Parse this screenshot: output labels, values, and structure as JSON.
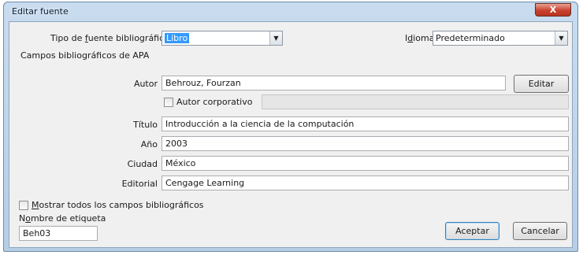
{
  "window": {
    "title": "Editar fuente",
    "close_glyph": "X"
  },
  "source_type": {
    "label_pre": "Tipo de ",
    "label_ul": "f",
    "label_post": "uente bibliográfica",
    "value": "Libro"
  },
  "language": {
    "label_pre": "I",
    "label_ul": "d",
    "label_post": "ioma",
    "value": "Predeterminado"
  },
  "section_title": "Campos bibliográficos de APA",
  "fields": {
    "author": {
      "label": "Autor",
      "value": "Behrouz, Fourzan"
    },
    "corporate_author": {
      "label": "Autor corporativo",
      "value": ""
    },
    "title": {
      "label": "Título",
      "value": "Introducción a la ciencia de la computación"
    },
    "year": {
      "label": "Año",
      "value": "2003"
    },
    "city": {
      "label": "Ciudad",
      "value": "México"
    },
    "publisher": {
      "label": "Editorial",
      "value": "Cengage Learning"
    }
  },
  "edit_button": "Editar",
  "show_all": {
    "label_ul": "M",
    "label_post": "ostrar todos los campos bibliográficos",
    "checked": false
  },
  "tag_name": {
    "label_pre": "N",
    "label_ul": "o",
    "label_post": "mbre de etiqueta",
    "value": "Beh03"
  },
  "buttons": {
    "accept": "Aceptar",
    "cancel": "Cancelar"
  },
  "icons": {
    "dropdown": "▼"
  },
  "colors": {
    "titlebar": "#c9dcef",
    "client": "#f0f0f0",
    "close": "#c8412e",
    "highlight": "#3399ff"
  }
}
